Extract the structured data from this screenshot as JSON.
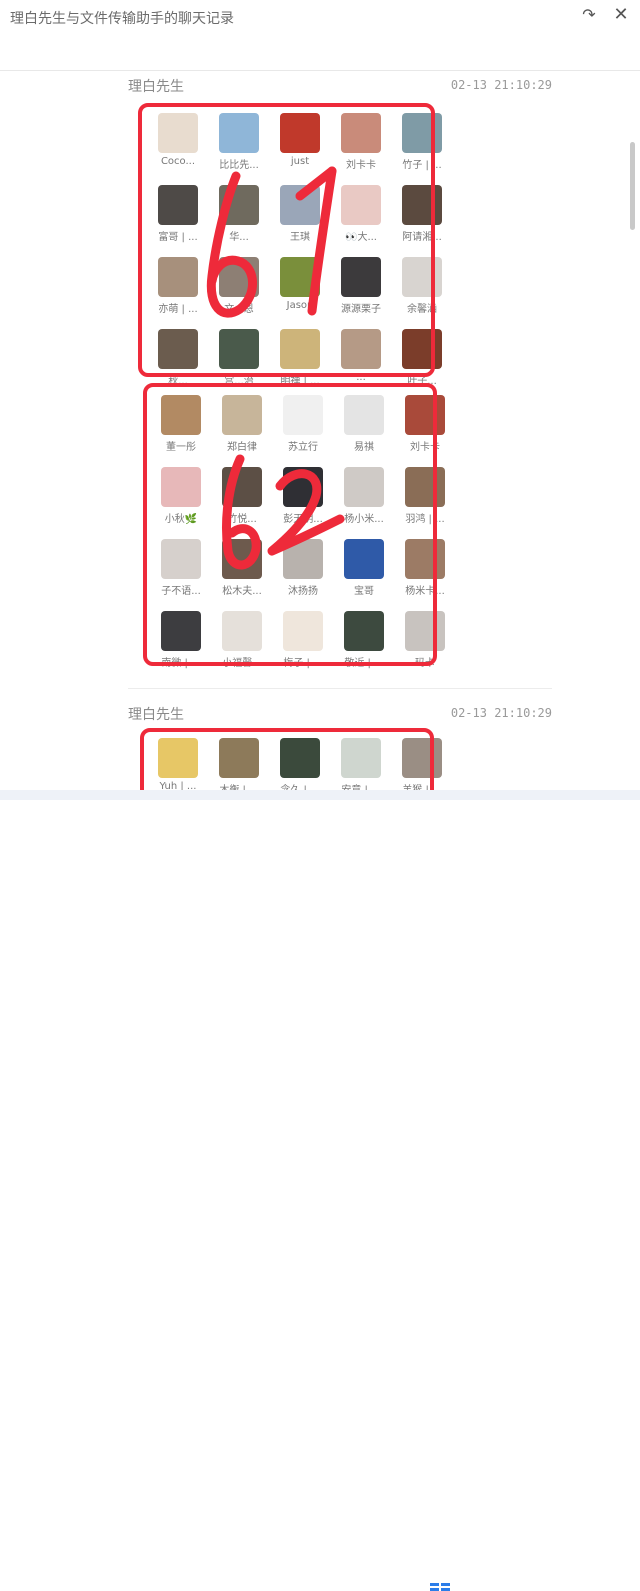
{
  "window": {
    "title": "理白先生与文件传输助手的聊天记录",
    "share_icon": "share-arrow-icon",
    "close_icon": "close-icon"
  },
  "messages": [
    {
      "sender": "理白先生",
      "time": "02-13 21:10:29",
      "cards": [
        {
          "annotation": "61",
          "contacts": [
            "Coco...",
            "比比先...",
            "just",
            "刘卡卡",
            "竹子 | ...",
            "富哥 | ...",
            "华...",
            "王琪",
            "👀大...",
            "阿请湘...",
            "亦萌 | ...",
            "文...恩",
            "Jason",
            "源源栗子",
            "余馨涵",
            "秋...",
            "宫...治",
            "明禅 | ...",
            "...",
            "叶子..."
          ]
        },
        {
          "annotation": "62",
          "contacts": [
            "董一彤",
            "郑白律",
            "苏立行",
            "易祺",
            "刘卡卡",
            "小秋🌿",
            "竹悦...",
            "彭天明...",
            "杨小米...",
            "羽鸿 | ...",
            "子不语...",
            "松木夫...",
            "沐扬扬",
            "宝哥",
            "杨米卡...",
            "南微 | ...",
            "小福馨...",
            "梅子 | ...",
            "敬近 | ...",
            "玛卡"
          ]
        }
      ]
    },
    {
      "sender": "理白先生",
      "time": "02-13 21:10:29",
      "cards": [
        {
          "contacts": [
            "Yuh | ...",
            "木衡 | ...",
            "念久 | ...",
            "安意 | ...",
            "羊猴 | ..."
          ]
        }
      ]
    }
  ],
  "colors": {
    "highlight": "#ee2a3a",
    "text_muted": "#8a8a8a",
    "avatars": [
      "#e8dccf",
      "#8fb6d8",
      "#c0392b",
      "#c98b7a",
      "#7f9ba6",
      "#4e4a47",
      "#6f6a5e",
      "#9aa6b8",
      "#e9c9c4",
      "#5b4a3f",
      "#a7907c",
      "#8d7f74",
      "#7a8f3b",
      "#3c3a3c",
      "#d8d4d0",
      "#6b5c4e",
      "#4a5a4b",
      "#cdb47a",
      "#b59a86",
      "#7b3d2a",
      "#b28a63",
      "#c7b59a",
      "#f0f0f0",
      "#e4e4e4",
      "#a94a3a",
      "#e7b8b9",
      "#5c4f45",
      "#2f2f34",
      "#cfcac6",
      "#8a6d56",
      "#d6d0cc",
      "#6d5a4d",
      "#b8b2ad",
      "#2f5aa8",
      "#9c7b65",
      "#3d3d40",
      "#e5e0da",
      "#efe6dc",
      "#3d4a3f",
      "#c8c3bf",
      "#e7c766",
      "#8d7a5a",
      "#3b4a3c",
      "#cfd6cf",
      "#9a8e84"
    ]
  }
}
